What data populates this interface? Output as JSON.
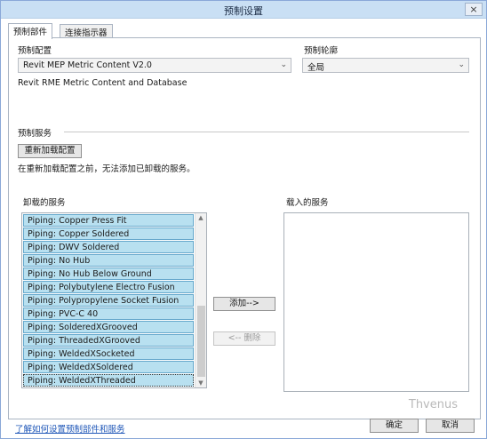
{
  "window": {
    "title": "预制设置",
    "close_glyph": "×"
  },
  "tabs": [
    {
      "label": "预制部件"
    },
    {
      "label": "连接指示器"
    }
  ],
  "config": {
    "label": "预制配置",
    "selected": "Revit MEP Metric Content V2.0",
    "description": "Revit RME Metric Content and Database"
  },
  "profile": {
    "label": "预制轮廓",
    "selected": "全局"
  },
  "services": {
    "section_label": "预制服务",
    "reload_label": "重新加载配置",
    "note": "在重新加载配置之前，无法添加已卸载的服务。",
    "unloaded_label": "卸载的服务",
    "loaded_label": "载入的服务",
    "unloaded_items": [
      "Piping: Copper Press Fit",
      "Piping: Copper Soldered",
      "Piping: DWV Soldered",
      "Piping: No Hub",
      "Piping: No Hub Below Ground",
      "Piping: Polybutylene Electro Fusion",
      "Piping: Polypropylene Socket Fusion",
      "Piping: PVC-C 40",
      "Piping: SolderedXGrooved",
      "Piping: ThreadedXGrooved",
      "Piping: WeldedXSocketed",
      "Piping: WeldedXSoldered",
      "Piping: WeldedXThreaded"
    ],
    "add_label": "添加-->",
    "remove_label": "<-- 删除"
  },
  "footer": {
    "help_link": "了解如何设置预制部件和服务",
    "ok_label": "确定",
    "cancel_label": "取消",
    "watermark": "Thvenus"
  }
}
